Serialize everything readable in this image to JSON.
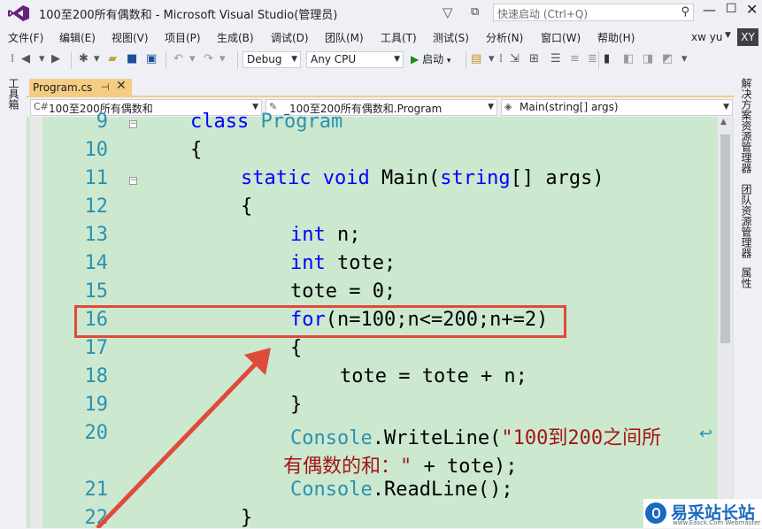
{
  "window": {
    "title": "100至200所有偶数和 - Microsoft Visual Studio(管理员)",
    "quick_launch_placeholder": "快速启动 (Ctrl+Q)"
  },
  "menu": [
    "文件(F)",
    "编辑(E)",
    "视图(V)",
    "项目(P)",
    "生成(B)",
    "调试(D)",
    "团队(M)",
    "工具(T)",
    "测试(S)",
    "分析(N)",
    "窗口(W)",
    "帮助(H)"
  ],
  "user": {
    "name": "xw yu",
    "initials": "XY"
  },
  "toolbar": {
    "config": "Debug",
    "platform": "Any CPU",
    "start_label": "启动"
  },
  "sidebar_left": {
    "toolbox": "工具箱"
  },
  "sidebar_right": [
    "解决方案资源管理器",
    "团队资源管理器",
    "属性"
  ],
  "document_tab": {
    "label": "Program.cs",
    "pin": "⊣",
    "close": "✕"
  },
  "navbar": {
    "project": "100至200所有偶数和",
    "class": "_100至200所有偶数和.Program",
    "member": "Main(string[] args)"
  },
  "code": {
    "line_numbers": [
      "9",
      "10",
      "11",
      "12",
      "13",
      "14",
      "15",
      "16",
      "17",
      "18",
      "19",
      "20",
      "21",
      "22"
    ],
    "line9_kw": "class",
    "line9_type": "Program",
    "brace_open": "{",
    "brace_close": "}",
    "line11_kw1": "static",
    "line11_kw2": "void",
    "line11_name": "Main(",
    "line11_kw3": "string",
    "line11_rest": "[] args)",
    "line13_kw": "int",
    "line13_rest": " n;",
    "line14_kw": "int",
    "line14_rest": " tote;",
    "line15": "tote = 0;",
    "line16_kw": "for",
    "line16_rest": "(n=100;n<=200;n+=2)",
    "line18": "tote = tote + n;",
    "line20_type": "Console",
    "line20_method": ".WriteLine(",
    "line20_str": "\"100到200之间所",
    "line20b_str": "有偶数的和：\"",
    "line20b_rest": " + tote);",
    "line21_type": "Console",
    "line21_rest": ".ReadLine();"
  },
  "watermark": {
    "text": "易采站长站",
    "url": "www.Easck.Com Webmaster"
  }
}
